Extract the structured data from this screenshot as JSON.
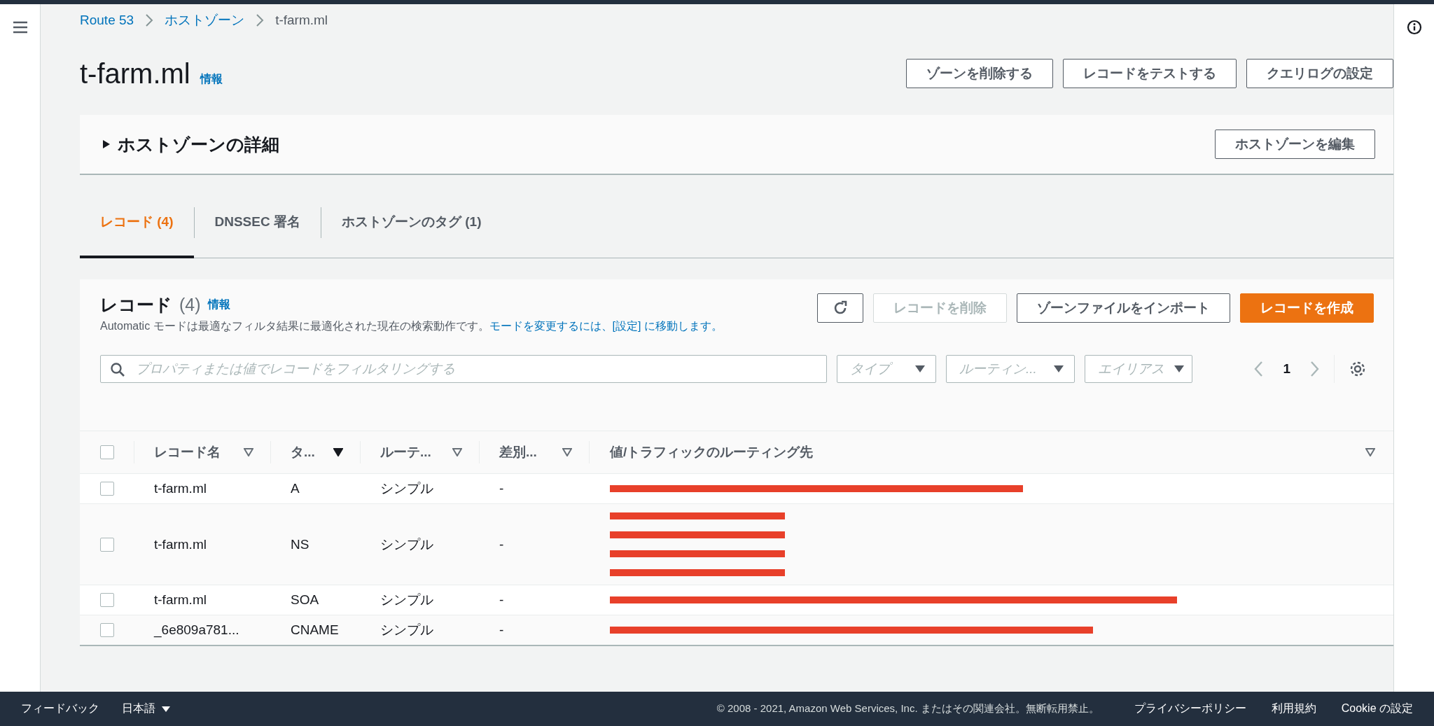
{
  "breadcrumb": [
    {
      "label": "Route 53",
      "link": true
    },
    {
      "label": "ホストゾーン",
      "link": true
    },
    {
      "label": "t-farm.ml",
      "link": false
    }
  ],
  "title": "t-farm.ml",
  "title_info": "情報",
  "header_buttons": [
    "ゾーンを削除する",
    "レコードをテストする",
    "クエリログの設定"
  ],
  "details": {
    "title": "ホストゾーンの詳細",
    "expanded": false,
    "edit_button": "ホストゾーンを編集"
  },
  "tabs": [
    {
      "label": "レコード (4)",
      "selected": true
    },
    {
      "label": "DNSSEC 署名",
      "selected": false
    },
    {
      "label": "ホストゾーンのタグ (1)",
      "selected": false
    }
  ],
  "records": {
    "title": "レコード",
    "count": "(4)",
    "info": "情報",
    "description": "Automatic モードは最適なフィルタ結果に最適化された現在の検索動作です。",
    "description_link": "モードを変更するには、[設定] に移動します。",
    "buttons": [
      {
        "label": "レコードを削除",
        "kind": "normal",
        "disabled": true
      },
      {
        "label": "ゾーンファイルをインポート",
        "kind": "normal",
        "disabled": false
      },
      {
        "label": "レコードを作成",
        "kind": "primary",
        "disabled": false
      }
    ],
    "search": {
      "placeholder": "プロパティまたは値でレコードをフィルタリングする"
    },
    "filters": [
      {
        "placeholder": "タイプ"
      },
      {
        "placeholder": "ルーティン..."
      },
      {
        "placeholder": "エイリアス"
      }
    ],
    "page": "1",
    "select_all": {
      "checked": false
    },
    "columns": [
      {
        "label": "レコード名",
        "sorted": false
      },
      {
        "label": "タ...",
        "sorted": true
      },
      {
        "label": "ルーテ...",
        "sorted": false
      },
      {
        "label": "差別...",
        "sorted": false
      },
      {
        "label": "値/トラフィックのルーティング先",
        "sorted": false
      }
    ],
    "rows": [
      {
        "checked": false,
        "name": "t-farm.ml",
        "type": "A",
        "routing": "シンプル",
        "differentiator": "-",
        "values": [
          {
            "kind": "redacted"
          }
        ]
      },
      {
        "checked": false,
        "name": "t-farm.ml",
        "type": "NS",
        "routing": "シンプル",
        "differentiator": "-",
        "values": [
          {
            "kind": "redacted"
          },
          {
            "kind": "redacted"
          },
          {
            "kind": "redacted"
          },
          {
            "kind": "redacted"
          }
        ]
      },
      {
        "checked": false,
        "name": "t-farm.ml",
        "type": "SOA",
        "routing": "シンプル",
        "differentiator": "-",
        "values": [
          {
            "kind": "redacted"
          }
        ]
      },
      {
        "checked": false,
        "name": "_6e809a781...",
        "type": "CNAME",
        "routing": "シンプル",
        "differentiator": "-",
        "values": [
          {
            "kind": "redacted"
          }
        ]
      }
    ]
  },
  "footer": {
    "feedback": "フィードバック",
    "language": "日本語",
    "copyright": "© 2008 - 2021, Amazon Web Services, Inc. またはその関連会社。無断転用禁止。",
    "links": [
      "プライバシーポリシー",
      "利用規約",
      "Cookie の設定"
    ]
  }
}
